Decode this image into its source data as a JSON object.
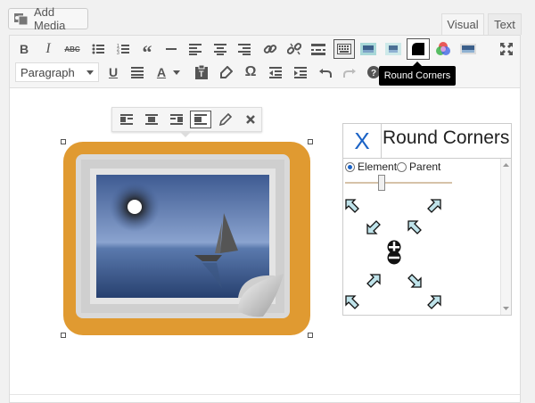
{
  "add_media": {
    "label": "Add Media"
  },
  "tabs": {
    "visual": "Visual",
    "text": "Text"
  },
  "toolbar": {
    "format_select": "Paragraph",
    "tooltip": "Round Corners",
    "row1": [
      "bold",
      "italic",
      "strikethrough",
      "bullet-list",
      "numbered-list",
      "blockquote",
      "horizontal-rule",
      "align-left",
      "align-center",
      "align-right",
      "insert-link",
      "remove-link",
      "toolbar-toggle",
      "image-plugin-1",
      "image-plugin-2",
      "round-corners",
      "color-plugin",
      "image-plugin-3",
      "fullscreen"
    ],
    "row2": [
      "underline",
      "justify",
      "text-color",
      "paste-as-text",
      "clear-formatting",
      "special-character",
      "decrease-indent",
      "increase-indent",
      "undo",
      "redo",
      "help"
    ]
  },
  "inline_toolbar": {
    "items": [
      "align-left",
      "align-center",
      "align-right",
      "align-none",
      "edit",
      "remove"
    ]
  },
  "panel": {
    "close": "X",
    "title": "Round Corners",
    "radio_element": "Element",
    "radio_parent": "Parent",
    "selected": "Element",
    "slider_value": 0.35
  },
  "colors": {
    "accent": "#1b63c6",
    "image_bg": "#e09a31",
    "tooltip_bg": "#000000"
  }
}
